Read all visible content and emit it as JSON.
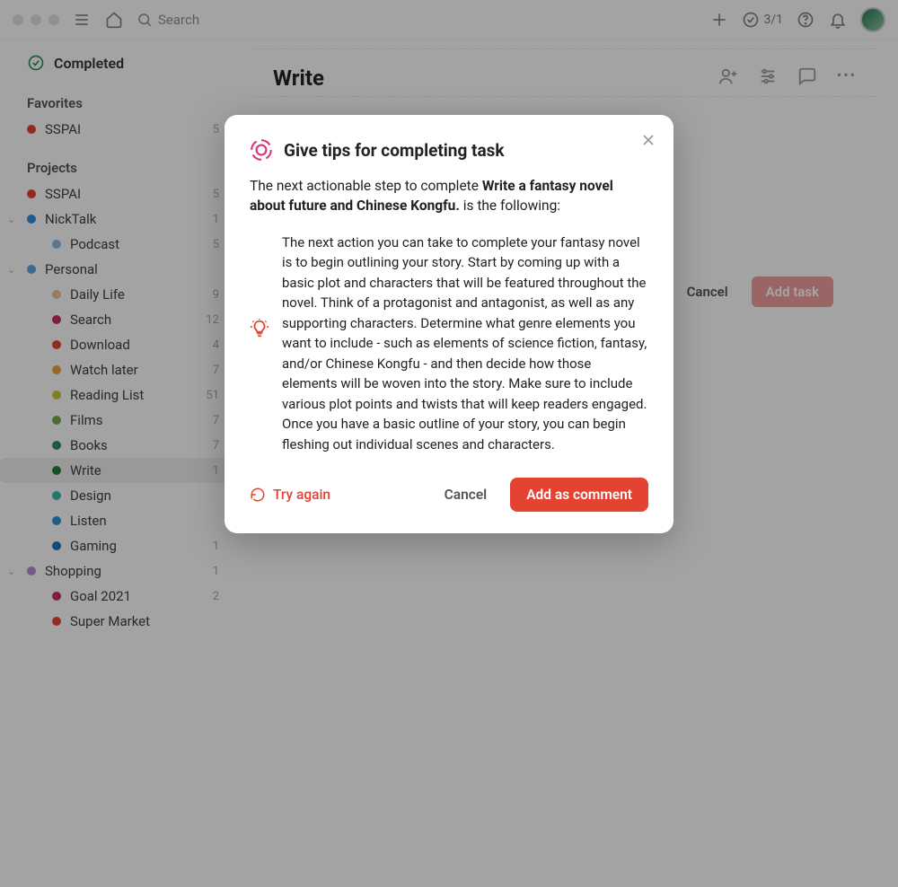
{
  "topbar": {
    "search_placeholder": "Search",
    "progress": "3/1"
  },
  "sidebar": {
    "completed_label": "Completed",
    "favorites_label": "Favorites",
    "favorites": [
      {
        "name": "SSPAI",
        "color": "#e44332",
        "count": "5"
      }
    ],
    "projects_label": "Projects",
    "projects": [
      {
        "name": "SSPAI",
        "color": "#e44332",
        "count": "5",
        "collapsible": false
      },
      {
        "name": "NickTalk",
        "color": "#2f8be0",
        "count": "1",
        "collapsible": true,
        "children": [
          {
            "name": "Podcast",
            "color": "#8fb6de",
            "count": "5"
          }
        ]
      },
      {
        "name": "Personal",
        "color": "#5aa6e2",
        "count": "",
        "collapsible": true,
        "children": [
          {
            "name": "Daily Life",
            "color": "#e9c19a",
            "count": "9"
          },
          {
            "name": "Search",
            "color": "#c22f6e",
            "count": "12"
          },
          {
            "name": "Download",
            "color": "#e44332",
            "count": "4"
          },
          {
            "name": "Watch later",
            "color": "#e5a23a",
            "count": "7"
          },
          {
            "name": "Reading List",
            "color": "#c7c43a",
            "count": "51"
          },
          {
            "name": "Films",
            "color": "#7aa64a",
            "count": "7"
          },
          {
            "name": "Books",
            "color": "#2e8b57",
            "count": "7"
          },
          {
            "name": "Write",
            "color": "#1f7a3e",
            "count": "1",
            "selected": true
          },
          {
            "name": "Design",
            "color": "#3bb4a6",
            "count": ""
          },
          {
            "name": "Listen",
            "color": "#2a8fd6",
            "count": ""
          },
          {
            "name": "Gaming",
            "color": "#1e6fb8",
            "count": "1"
          }
        ]
      },
      {
        "name": "Shopping",
        "color": "#b089d8",
        "count": "1",
        "collapsible": true,
        "children": [
          {
            "name": "Goal 2021",
            "color": "#c22f6e",
            "count": "2"
          },
          {
            "name": "Super Market",
            "color": "#e44332",
            "count": ""
          }
        ]
      }
    ]
  },
  "main": {
    "title": "Write",
    "cancel_label": "Cancel",
    "add_task_label": "Add task"
  },
  "modal": {
    "title": "Give tips for completing task",
    "intro_prefix": "The next actionable step to complete ",
    "intro_bold": "Write a fantasy novel about future and Chinese Kongfu.",
    "intro_suffix": " is the following:",
    "tip": "The next action you can take to complete your fantasy novel is to begin outlining your story. Start by coming up with a basic plot and characters that will be featured throughout the novel. Think of a protagonist and antagonist, as well as any supporting characters. Determine what genre elements you want to include - such as elements of science fiction, fantasy, and/or Chinese Kongfu - and then decide how those elements will be woven into the story. Make sure to include various plot points and twists that will keep readers engaged. Once you have a basic outline of your story, you can begin fleshing out individual scenes and characters.",
    "try_again_label": "Try again",
    "cancel_label": "Cancel",
    "primary_label": "Add as comment"
  }
}
